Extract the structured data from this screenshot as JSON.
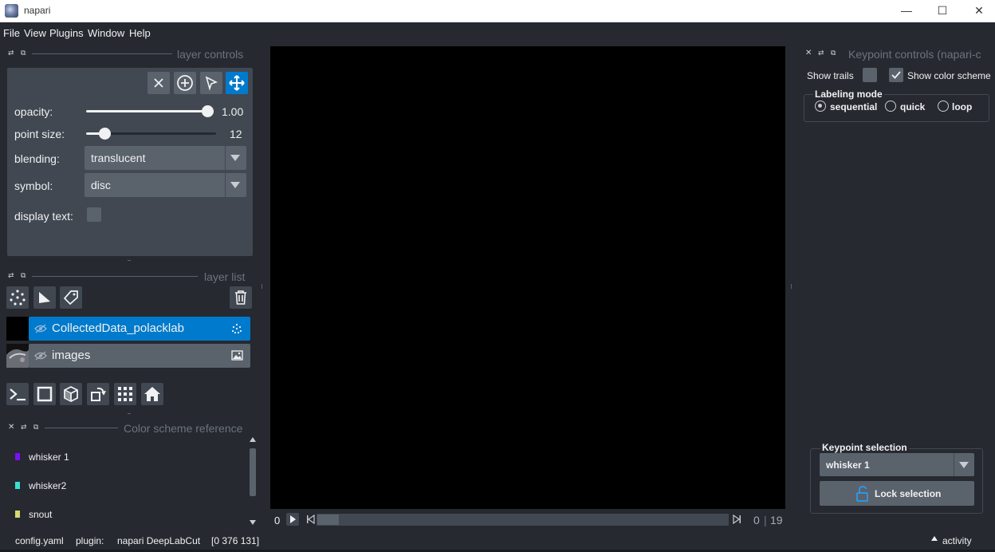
{
  "window": {
    "title": "napari",
    "minimize_glyph": "—",
    "maximize_glyph": "☐",
    "close_glyph": "✕"
  },
  "menubar": {
    "items": [
      "File",
      "View",
      "Plugins",
      "Window",
      "Help"
    ]
  },
  "layer_controls": {
    "title": "layer controls",
    "opacity_label": "opacity:",
    "opacity_value": "1.00",
    "opacity_fraction": 1.0,
    "point_size_label": "point size:",
    "point_size_value": "12",
    "point_size_fraction": 0.15,
    "blending_label": "blending:",
    "blending_value": "translucent",
    "symbol_label": "symbol:",
    "symbol_value": "disc",
    "display_text_label": "display text:",
    "display_text_checked": false,
    "accent": "#007acc"
  },
  "layer_list": {
    "title": "layer list",
    "layers": [
      {
        "name": "CollectedData_polacklab",
        "type_icon": "points-icon",
        "selected": true,
        "visible": true
      },
      {
        "name": "images",
        "type_icon": "image-icon",
        "selected": false,
        "visible": true
      }
    ]
  },
  "color_scheme": {
    "title": "Color scheme reference",
    "entries": [
      {
        "label": "whisker 1",
        "color": "#7a10f5"
      },
      {
        "label": "whisker2",
        "color": "#38e0d0"
      },
      {
        "label": "snout",
        "color": "#d8d870"
      }
    ]
  },
  "dims": {
    "axis_label": "0",
    "current": "0",
    "separator": "|",
    "max": "19",
    "position_fraction": 0.0
  },
  "keypoint_controls": {
    "title": "Keypoint controls (napari-c",
    "show_trails_label": "Show trails",
    "show_trails_checked": false,
    "show_color_scheme_label": "Show color scheme",
    "show_color_scheme_checked": true,
    "labeling_mode_title": "Labeling mode",
    "modes": [
      "sequential",
      "quick",
      "loop"
    ],
    "selected_mode": "sequential",
    "keypoint_selection_title": "Keypoint selection",
    "keypoint_selected": "whisker 1",
    "lock_label": "Lock selection"
  },
  "status": {
    "file": "config.yaml",
    "plugin_label": "plugin:",
    "plugin_value": "napari DeepLabCut",
    "coords": "[0 376 131]",
    "activity_label": "activity"
  }
}
